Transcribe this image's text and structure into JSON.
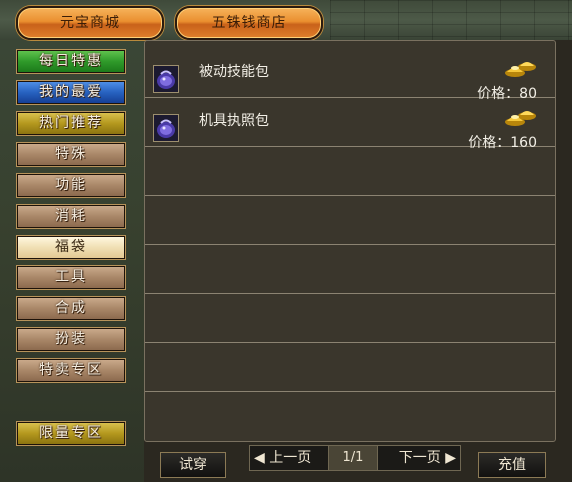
{
  "top_tabs": {
    "yuanbao": "元宝商城",
    "wuzhu": "五铢钱商店"
  },
  "nav": [
    {
      "label": "每日特惠",
      "style": "green"
    },
    {
      "label": "我的最爱",
      "style": "blue"
    },
    {
      "label": "热门推荐",
      "style": "gold"
    },
    {
      "label": "特殊",
      "style": "brown"
    },
    {
      "label": "功能",
      "style": "brown"
    },
    {
      "label": "消耗",
      "style": "brown"
    },
    {
      "label": "福袋",
      "style": "active"
    },
    {
      "label": "工具",
      "style": "brown"
    },
    {
      "label": "合成",
      "style": "brown"
    },
    {
      "label": "扮装",
      "style": "brown"
    },
    {
      "label": "特卖专区",
      "style": "brown"
    },
    {
      "label": "限量专区",
      "style": "gold"
    }
  ],
  "items": [
    {
      "name": "被动技能包",
      "price": "价格：80",
      "icon": "skill-bag-icon"
    },
    {
      "name": "机具执照包",
      "price": "价格：160",
      "icon": "license-bag-icon"
    }
  ],
  "bottom": {
    "try_on": "试穿",
    "prev_page": "上一页",
    "page": "1/1",
    "next_page": "下一页",
    "recharge": "充值"
  },
  "colors": {
    "tab_orange": "#ea8f2f",
    "nav_brown": "#a98768",
    "nav_green": "#2f9a2a",
    "nav_blue": "#2762c0",
    "nav_gold": "#b4981e",
    "panel_bg": "#3a362c"
  }
}
